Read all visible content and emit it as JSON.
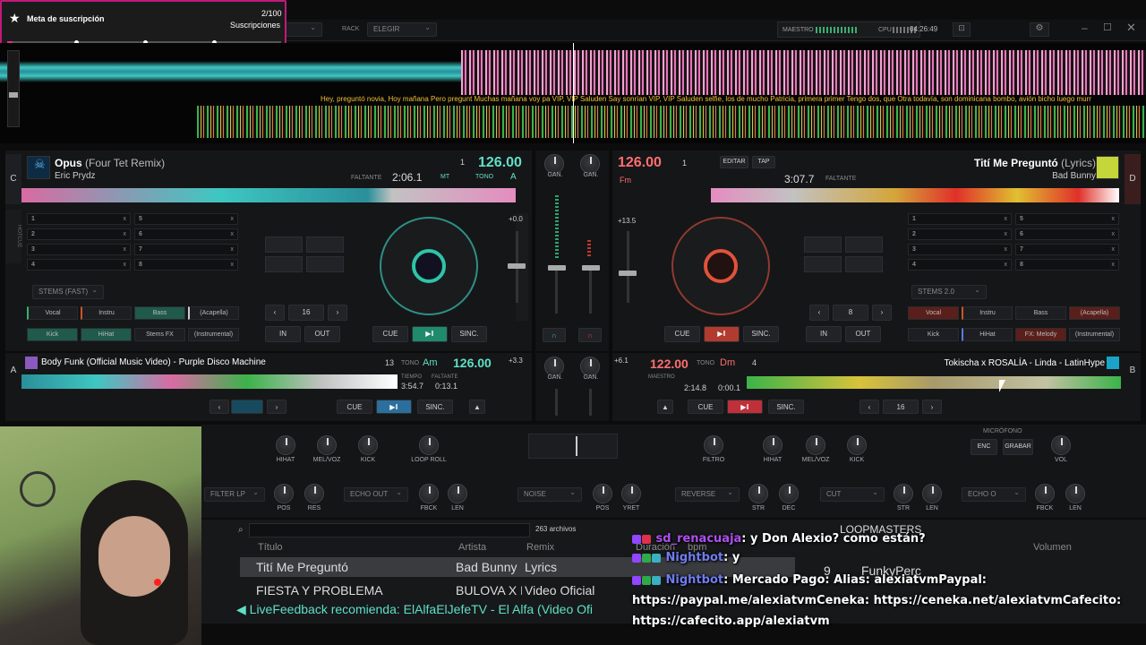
{
  "subgoal": {
    "title": "Meta de suscripción",
    "count": "2/100",
    "label": "Suscripciones"
  },
  "topbar": {
    "rack_label": "RACK",
    "rack_value": "ELEGIR",
    "master_label": "MAESTRO",
    "cpu_label": "CPU",
    "clock": "04:26:49"
  },
  "lyrics": "Hey, preguntó novia, Hoy mañana Pero pregunt   Muchas mañana voy pa VIP, VIP Saluden Say sonrían VIP, VIP Saluden selfie, los de mucho Patricia, primera primer Tengo dos, que Otra todavía, son dominicana bombo, avión bicho luego murr",
  "deck1": {
    "letter": "C",
    "title": "Opus",
    "remix": "(Four Tet Remix)",
    "artist": "Eric Prydz",
    "bpm": "126.00",
    "num": "1",
    "faltante_label": "FALTANTE",
    "time": "2:06.1",
    "key": "A",
    "tono": "TONO",
    "pitch": "+0.0",
    "loop": "16",
    "stems_sel": "STEMS (FAST)",
    "stems": [
      "Vocal",
      "Instru",
      "Bass",
      "(Acapella)",
      "Kick",
      "HiHat",
      "Stems FX",
      "(Instrumental)"
    ],
    "hotcues": [
      "1",
      "2",
      "3",
      "4",
      "5",
      "6",
      "7",
      "8"
    ]
  },
  "deck2": {
    "letter": "D",
    "title": "Tití Me Preguntó",
    "remix": "(Lyrics)",
    "artist": "Bad Bunny",
    "bpm": "126.00",
    "num": "1",
    "time": "3:07.7",
    "faltante_label": "FALTANTE",
    "key": "Fm",
    "pitch": "+13.5",
    "loop": "8",
    "stems_sel": "STEMS 2.0",
    "stems": [
      "Vocal",
      "Instru",
      "Bass",
      "(Acapella)",
      "Kick",
      "HiHat",
      "FX: Melody",
      "(Instrumental)"
    ],
    "hotcues": [
      "1",
      "2",
      "3",
      "4",
      "5",
      "6",
      "7",
      "8"
    ],
    "edit": "EDITAR",
    "tap": "TAP"
  },
  "deck3": {
    "letter": "A",
    "title": "Body Funk (Official Music Video) - Purple Disco Machine",
    "bpm": "126.00",
    "num": "13",
    "tono": "TONO",
    "key": "Am",
    "tiempo_label": "TIEMPO",
    "faltante_label": "FALTANTE",
    "time": "3:54.7",
    "remain": "0:13.1",
    "pitch": "+3.3"
  },
  "deck4": {
    "letter": "B",
    "title": "Tokischa x ROSALÍA - Linda - LatinHype",
    "bpm": "122.00",
    "num": "4",
    "tono": "TONO",
    "key": "Dm",
    "time": "2:14.8",
    "remain": "0:00.1",
    "pitch": "+6.1",
    "loop": "16"
  },
  "transport": {
    "cue": "CUE",
    "sync": "SINC.",
    "in": "IN",
    "out": "OUT",
    "gain": "GAN.",
    "master": "MAESTRO",
    "sinc": "SINC.",
    "mt": "MT",
    "tiempo": "TIEMPO",
    "faltante": "FALTANTE"
  },
  "fx": {
    "filter_lp": "FILTER LP",
    "echo_out": "ECHO OUT",
    "noise": "NOISE",
    "reverse": "REVERSE",
    "cut": "CUT",
    "echo_o": "ECHO O",
    "hihat": "HIHAT",
    "melvoz": "MEL/VOZ",
    "kick": "KICK",
    "loop_roll": "LOOP ROLL",
    "filtro": "FILTRO",
    "pos": "POS",
    "res": "RES",
    "fbck": "FBCK",
    "len": "LEN",
    "yret": "YRET",
    "str": "STR",
    "dec": "DEC",
    "vol": "VOL",
    "microfono": "MICRÓFONO",
    "enc": "ENC",
    "grabar": "GRABAR"
  },
  "browser": {
    "count": "263 archivos",
    "col_title": "Título",
    "col_artist": "Artista",
    "col_remix": "Remix",
    "col_duration": "Duración",
    "col_bpm": "bpm",
    "rows": [
      {
        "title": "Tití Me Preguntó",
        "artist": "Bad Bunny",
        "remix": "Lyrics"
      },
      {
        "title": "FIESTA Y PROBLEMA",
        "artist": "BULOVA X B...",
        "remix": "Video Oficial"
      }
    ],
    "livefeed": "LiveFeedback recomienda: ElAlfaElJefeTV - El Alfa (Video Ofi",
    "loopmasters": "LOOPMASTERS",
    "volumen": "Volumen",
    "sample_num": "9",
    "sample_name": "FunkyPerc"
  },
  "chat": [
    {
      "user": "sd_renacuaja",
      "color": "#b04ff0",
      "text": ": y Don Alexio? como están?"
    },
    {
      "user": "Nightbot",
      "color": "#6f7df2",
      "text": ": y"
    },
    {
      "user": "Nightbot",
      "color": "#6f7df2",
      "text": ": Mercado Pago: Alias: alexiatvmPaypal: https://paypal.me/alexiatvmCeneka: https://ceneka.net/alexiatvmCafecito: https://cafecito.app/alexiatvm"
    }
  ]
}
